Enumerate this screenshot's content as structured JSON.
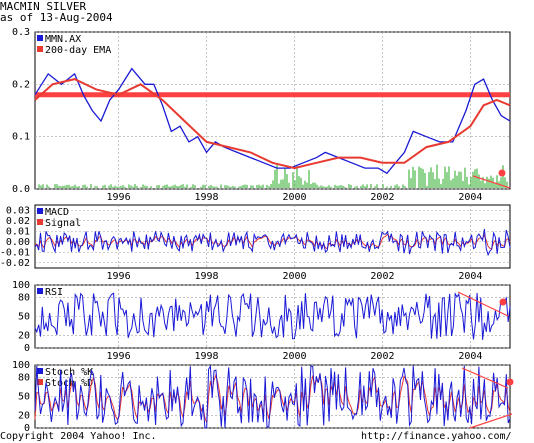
{
  "header": {
    "symbol_title": "MACMIN SILVER",
    "date_line": "as of 13-Aug-2004"
  },
  "footer": {
    "copyright": "Copyright 2004 Yahoo! Inc.",
    "url": "http://finance.yahoo.com/"
  },
  "colors": {
    "price": "#1a1ad6",
    "ema": "#e83a30",
    "volume": "#22aa22",
    "grid": "#a0a0a0",
    "hline": "#ff4040"
  },
  "chart_data": [
    {
      "type": "line",
      "panel": "price",
      "x_tick_labels": [
        "1996",
        "1998",
        "2000",
        "2002",
        "2004"
      ],
      "x_tick_values": [
        1996,
        1998,
        2000,
        2002,
        2004
      ],
      "y_tick_labels": [
        "0.3",
        "0.2",
        "0.1",
        "0.0"
      ],
      "y_tick_values": [
        0.3,
        0.2,
        0.1,
        0.0
      ],
      "ylim": [
        0,
        0.3
      ],
      "xlim": [
        1994.1,
        2004.9
      ],
      "legend": [
        "MMN.AX",
        "200-day EMA"
      ],
      "series": [
        {
          "name": "MMN.AX",
          "x": [
            1994.1,
            1994.4,
            1994.7,
            1995.0,
            1995.2,
            1995.4,
            1995.6,
            1995.8,
            1996.0,
            1996.3,
            1996.6,
            1996.8,
            1997.0,
            1997.2,
            1997.4,
            1997.6,
            1997.8,
            1998.0,
            1998.2,
            1998.4,
            1998.7,
            1999.0,
            1999.3,
            1999.6,
            1999.9,
            2000.2,
            2000.5,
            2000.7,
            2001.0,
            2001.3,
            2001.6,
            2001.9,
            2002.1,
            2002.3,
            2002.5,
            2002.7,
            2003.0,
            2003.3,
            2003.6,
            2003.9,
            2004.1,
            2004.3,
            2004.5,
            2004.7,
            2004.9
          ],
          "values": [
            0.18,
            0.22,
            0.2,
            0.22,
            0.18,
            0.15,
            0.13,
            0.17,
            0.19,
            0.23,
            0.2,
            0.2,
            0.16,
            0.11,
            0.12,
            0.09,
            0.1,
            0.07,
            0.09,
            0.08,
            0.07,
            0.06,
            0.05,
            0.04,
            0.04,
            0.05,
            0.06,
            0.07,
            0.06,
            0.05,
            0.04,
            0.04,
            0.03,
            0.05,
            0.07,
            0.11,
            0.1,
            0.09,
            0.09,
            0.15,
            0.2,
            0.21,
            0.17,
            0.14,
            0.13
          ]
        },
        {
          "name": "200-day EMA",
          "x": [
            1994.1,
            1994.5,
            1995.0,
            1995.5,
            1996.0,
            1996.5,
            1997.0,
            1997.5,
            1998.0,
            1998.5,
            1999.0,
            1999.5,
            2000.0,
            2000.5,
            2001.0,
            2001.5,
            2002.0,
            2002.5,
            2003.0,
            2003.5,
            2004.0,
            2004.3,
            2004.6,
            2004.9
          ],
          "values": [
            0.17,
            0.2,
            0.21,
            0.19,
            0.18,
            0.2,
            0.17,
            0.13,
            0.09,
            0.08,
            0.07,
            0.05,
            0.04,
            0.05,
            0.06,
            0.06,
            0.05,
            0.05,
            0.08,
            0.09,
            0.12,
            0.16,
            0.17,
            0.16
          ]
        }
      ]
    },
    {
      "type": "line",
      "panel": "macd",
      "x_tick_labels": [
        "1996",
        "1998",
        "2000",
        "2002",
        "2004"
      ],
      "x_tick_values": [
        1996,
        1998,
        2000,
        2002,
        2004
      ],
      "y_tick_labels": [
        "0.03",
        "0.02",
        "0.01",
        "0.00",
        "-0.01",
        "-0.02"
      ],
      "y_tick_values": [
        0.03,
        0.02,
        0.01,
        0.0,
        -0.01,
        -0.02
      ],
      "ylim": [
        -0.025,
        0.035
      ],
      "xlim": [
        1994.1,
        2004.9
      ],
      "legend": [
        "MACD",
        "Signal"
      ]
    },
    {
      "type": "line",
      "panel": "rsi",
      "x_tick_labels": [
        "1996",
        "1998",
        "2000",
        "2002",
        "2004"
      ],
      "x_tick_values": [
        1996,
        1998,
        2000,
        2002,
        2004
      ],
      "y_tick_labels": [
        "100",
        "80",
        "50",
        "20",
        "0"
      ],
      "y_tick_values": [
        100,
        80,
        50,
        20,
        0
      ],
      "ylim": [
        0,
        100
      ],
      "xlim": [
        1994.1,
        2004.9
      ],
      "legend": [
        "RSI"
      ]
    },
    {
      "type": "line",
      "panel": "stochastic",
      "y_tick_labels": [
        "100",
        "80",
        "50",
        "20",
        "0"
      ],
      "y_tick_values": [
        100,
        80,
        50,
        20,
        0
      ],
      "ylim": [
        0,
        100
      ],
      "xlim": [
        1994.1,
        2004.9
      ],
      "legend": [
        "Stoch %K",
        "Stoch %D"
      ]
    }
  ]
}
